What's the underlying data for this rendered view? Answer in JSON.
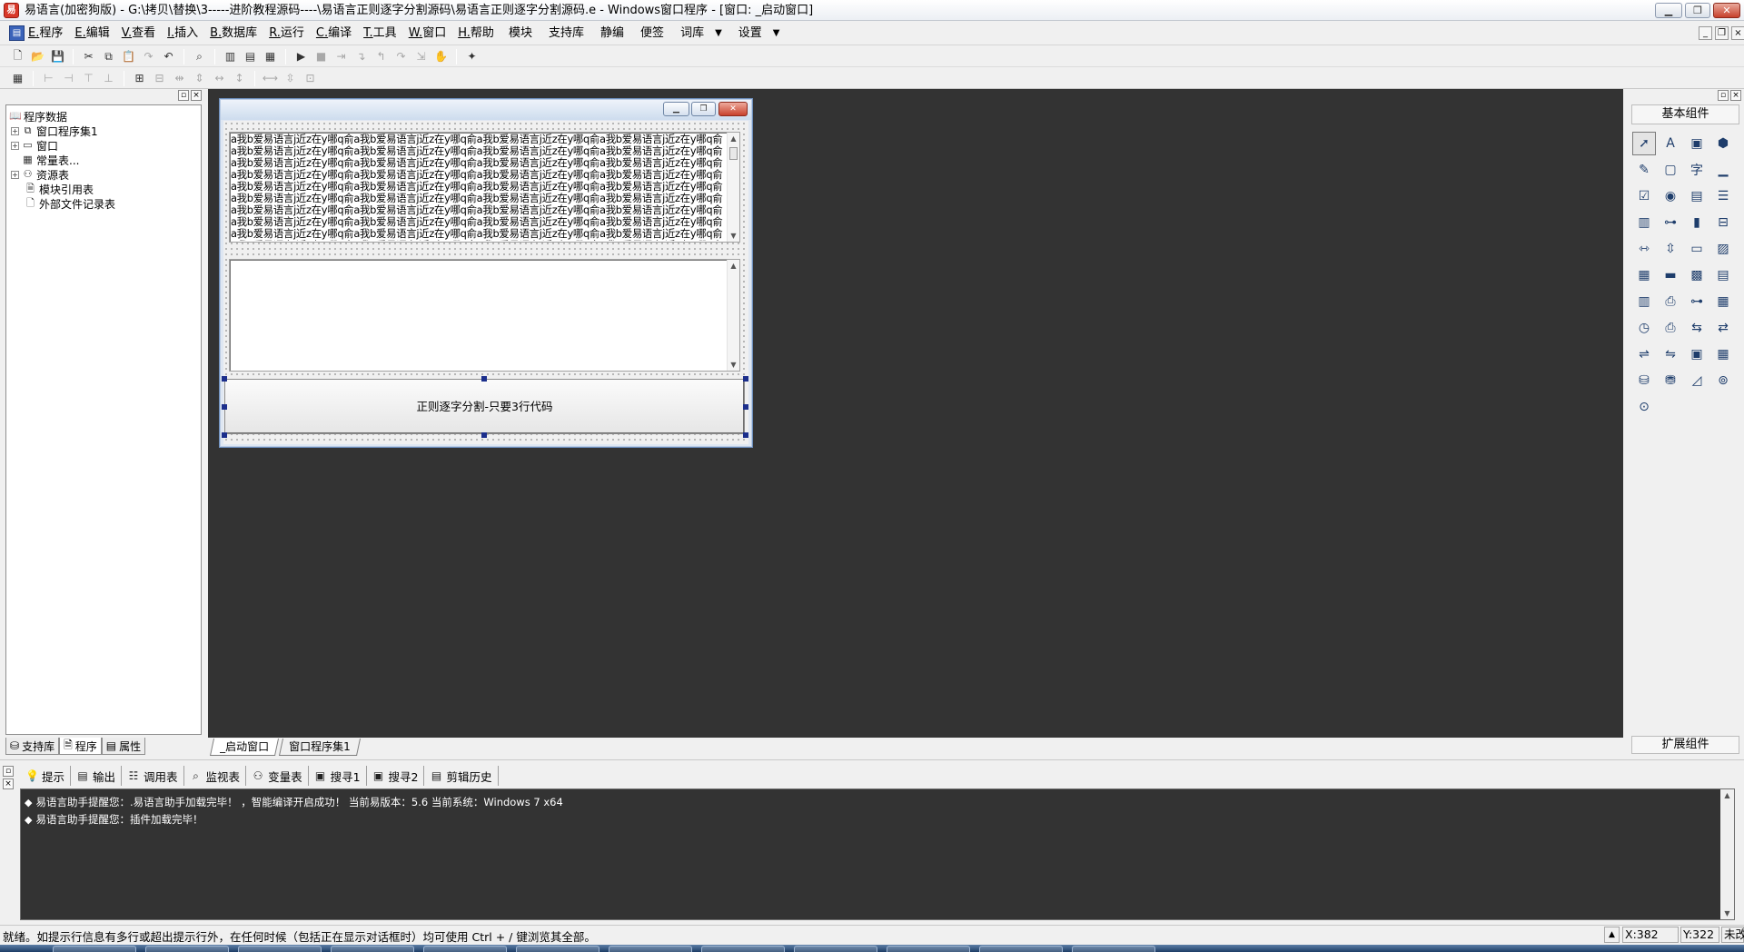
{
  "window": {
    "title": "易语言(加密狗版) - G:\\拷贝\\替换\\3-----进阶教程源码----\\易语言正则逐字分割源码\\易语言正则逐字分割源码.e - Windows窗口程序 - [窗口: _启动窗口]",
    "min": "▁",
    "max": "❐",
    "close": "✕"
  },
  "menu": {
    "left": [
      "E.程序",
      "E.编辑",
      "V.查看",
      "I.插入",
      "B.数据库",
      "R.运行",
      "C.编译",
      "T.工具",
      "W.窗口",
      "H.帮助"
    ],
    "right": [
      {
        "label": "模块",
        "dropdown": false
      },
      {
        "label": "支持库",
        "dropdown": false
      },
      {
        "label": "静编",
        "dropdown": false
      },
      {
        "label": "便签",
        "dropdown": false
      },
      {
        "label": "词库",
        "dropdown": true
      },
      {
        "label": "设置",
        "dropdown": true
      }
    ],
    "mdi": [
      "_",
      "❐",
      "×"
    ]
  },
  "toolbar1": [
    "new-file-icon",
    "open-file-icon",
    "save-icon",
    "|",
    "cut-icon",
    "copy-icon",
    "paste-icon",
    "redo-icon",
    "undo-icon",
    "|",
    "find-icon",
    "|",
    "layout-left-icon",
    "layout-top-icon",
    "layout-split-icon",
    "|",
    "run-icon",
    "stop-icon",
    "step-icon",
    "step-into-icon",
    "step-out-icon",
    "step-over-icon",
    "run-to-cursor-icon",
    "breakpoint-icon",
    "|",
    "helper-icon"
  ],
  "toolbar2": [
    "grid-icon",
    "|",
    "align-left-icon",
    "align-right-icon",
    "align-top-icon",
    "align-bottom-icon",
    "|",
    "center-h-icon",
    "center-v-icon",
    "space-h-icon",
    "space-v-icon",
    "size-h-icon",
    "size-v-icon",
    "|",
    "same-width-icon",
    "same-height-icon",
    "same-size-icon"
  ],
  "left_panel": {
    "tree": [
      {
        "label": "程序数据",
        "icon": "book-icon",
        "expander": false,
        "level": 0
      },
      {
        "label": "窗口程序集1",
        "icon": "module-icon",
        "expander": true,
        "level": 1
      },
      {
        "label": "窗口",
        "icon": "window-icon",
        "expander": true,
        "level": 1
      },
      {
        "label": "常量表...",
        "icon": "constant-icon",
        "expander": false,
        "level": 1
      },
      {
        "label": "资源表",
        "icon": "resource-icon",
        "expander": true,
        "level": 1
      },
      {
        "label": "模块引用表",
        "icon": "module-ref-icon",
        "expander": false,
        "level": 2
      },
      {
        "label": "外部文件记录表",
        "icon": "file-record-icon",
        "expander": false,
        "level": 2
      }
    ],
    "tabs": [
      {
        "label": "支持库",
        "icon": "library-icon"
      },
      {
        "label": "程序",
        "icon": "program-icon"
      },
      {
        "label": "属性",
        "icon": "property-icon"
      }
    ]
  },
  "center_tabs": [
    "_启动窗口",
    "窗口程序集1"
  ],
  "design_form": {
    "edit1_pattern": "a我b爱易语言j近z在y哪q俞",
    "edit1_repeat": 40,
    "button_label": "正则逐字分割-只要3行代码"
  },
  "right_panel": {
    "title": "基本组件",
    "ext_title": "扩展组件",
    "icons": [
      "pointer-icon",
      "label-icon",
      "picture-box-icon",
      "shape-icon",
      "edit-box-icon",
      "group-box-icon",
      "text-char-icon",
      "line-icon",
      "checkbox-icon",
      "radio-icon",
      "combo-box-icon",
      "list-box-icon",
      "multi-list-icon",
      "slider-icon",
      "progress-icon",
      "tab-icon",
      "hscroll-icon",
      "vscroll-icon",
      "toolbar-icon",
      "image-list-icon",
      "calendar-icon",
      "status-bar-icon",
      "folder-icon",
      "document-icon",
      "datetime-icon",
      "printer-icon",
      "tree-icon",
      "table-icon",
      "timer-icon",
      "printer2-icon",
      "client-icon",
      "server-icon",
      "network-icon",
      "port-icon",
      "window-frame-icon",
      "grid-frame-icon",
      "db-provider-icon",
      "db-source-icon",
      "chart-icon",
      "odbc-icon",
      "odbc2-icon"
    ]
  },
  "bottom_panel": {
    "side": [
      "▫",
      "×"
    ],
    "tabs": [
      {
        "label": "提示",
        "icon": "hint-icon"
      },
      {
        "label": "输出",
        "icon": "output-icon"
      },
      {
        "label": "调用表",
        "icon": "callstack-icon"
      },
      {
        "label": "监视表",
        "icon": "watch-icon"
      },
      {
        "label": "变量表",
        "icon": "variables-icon"
      },
      {
        "label": "搜寻1",
        "icon": "search1-icon"
      },
      {
        "label": "搜寻2",
        "icon": "search2-icon"
      },
      {
        "label": "剪辑历史",
        "icon": "clip-history-icon"
      }
    ],
    "output": [
      "易语言助手提醒您：.易语言助手加载完毕！  ，智能编译开启成功！  当前易版本：5.6  当前系统：Windows 7 x64",
      "易语言助手提醒您：插件加载完毕！"
    ]
  },
  "status": {
    "text": "就绪。如提示行信息有多行或超出提示行外，在任何时候（包括正在显示对话框时）均可使用 Ctrl + / 键浏览其全部。",
    "x": "X:382",
    "y": "Y:322",
    "modified": "未改"
  },
  "colors": {
    "workspace": "#333333",
    "output_bg": "#333333",
    "selection_handle": "#1c2f8c",
    "close_red": "#c8412d"
  }
}
